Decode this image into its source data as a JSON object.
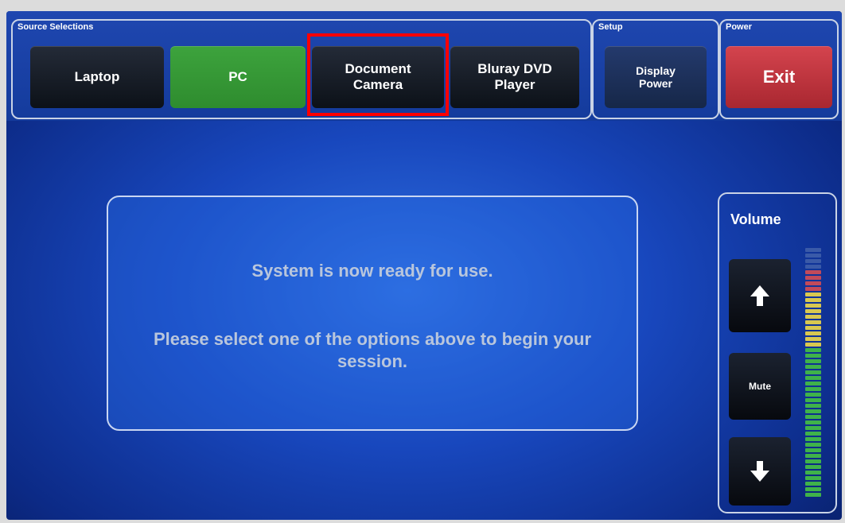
{
  "source_group": {
    "label": "Source Selections",
    "buttons": [
      {
        "label": "Laptop",
        "state": "inactive"
      },
      {
        "label": "PC",
        "state": "active"
      },
      {
        "label": "Document\nCamera",
        "state": "inactive"
      },
      {
        "label": "Bluray DVD\nPlayer",
        "state": "inactive"
      }
    ]
  },
  "setup_group": {
    "label": "Setup",
    "button": {
      "label": "Display\nPower"
    }
  },
  "power_group": {
    "label": "Power",
    "button": {
      "label": "Exit"
    }
  },
  "message": {
    "line1": "System is now ready for use.",
    "line2": "Please select one of the options above to begin your session."
  },
  "volume": {
    "title": "Volume",
    "mute_label": "Mute",
    "up_icon": "arrow-up-icon",
    "down_icon": "arrow-down-icon"
  },
  "colors": {
    "active_green": "#3da33d",
    "exit_red": "#d4444e",
    "highlight": "#ff0000"
  }
}
